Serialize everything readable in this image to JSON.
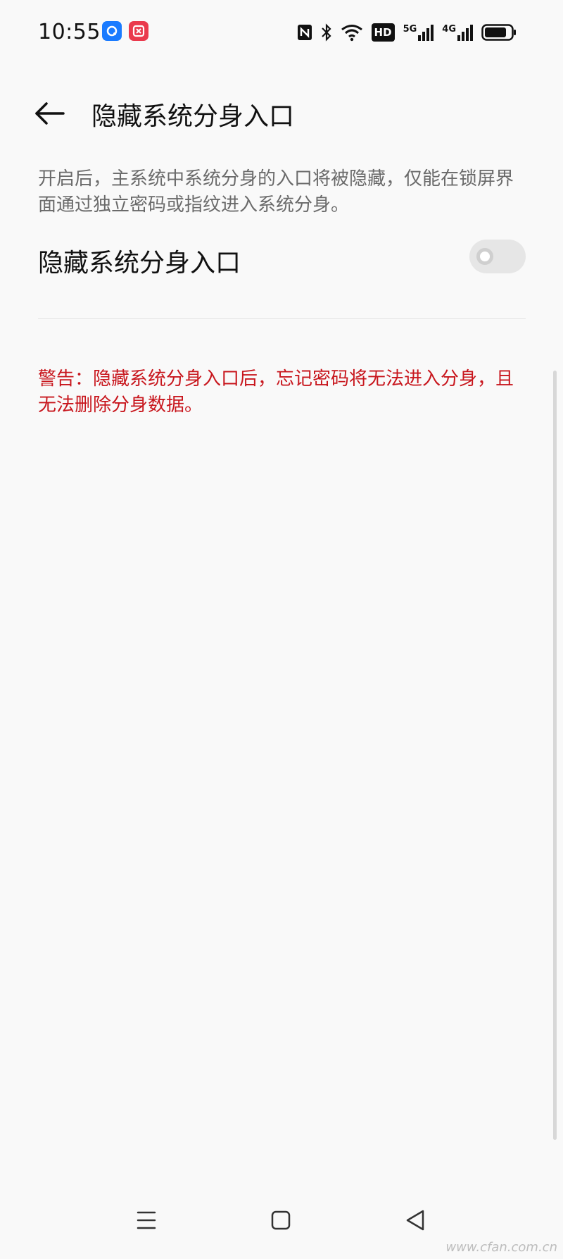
{
  "status_bar": {
    "time": "10:55",
    "app_icons": [
      "app-badge-blue",
      "app-badge-red"
    ],
    "indicators": [
      "nfc-icon",
      "bluetooth-icon",
      "wifi-icon",
      "hd-icon",
      "signal-5g-icon",
      "signal-4g-icon",
      "battery-icon"
    ],
    "hd_label": "HD",
    "net1_label": "5G",
    "net2_label": "4G"
  },
  "header": {
    "back_icon": "arrow-left-icon",
    "title": "隐藏系统分身入口"
  },
  "content": {
    "description": "开启后，主系统中系统分身的入口将被隐藏，仅能在锁屏界面通过独立密码或指纹进入系统分身。",
    "setting_label": "隐藏系统分身入口",
    "setting_enabled": false,
    "warning": "警告：隐藏系统分身入口后，忘记密码将无法进入分身，且无法删除分身数据。"
  },
  "navigation": {
    "items": [
      "menu-icon",
      "home-icon",
      "back-triangle-icon"
    ]
  },
  "watermark": "www.cfan.com.cn",
  "colors": {
    "background": "#f9f9f9",
    "warning": "#c8161d",
    "toggle_off": "#e6e6e6"
  }
}
